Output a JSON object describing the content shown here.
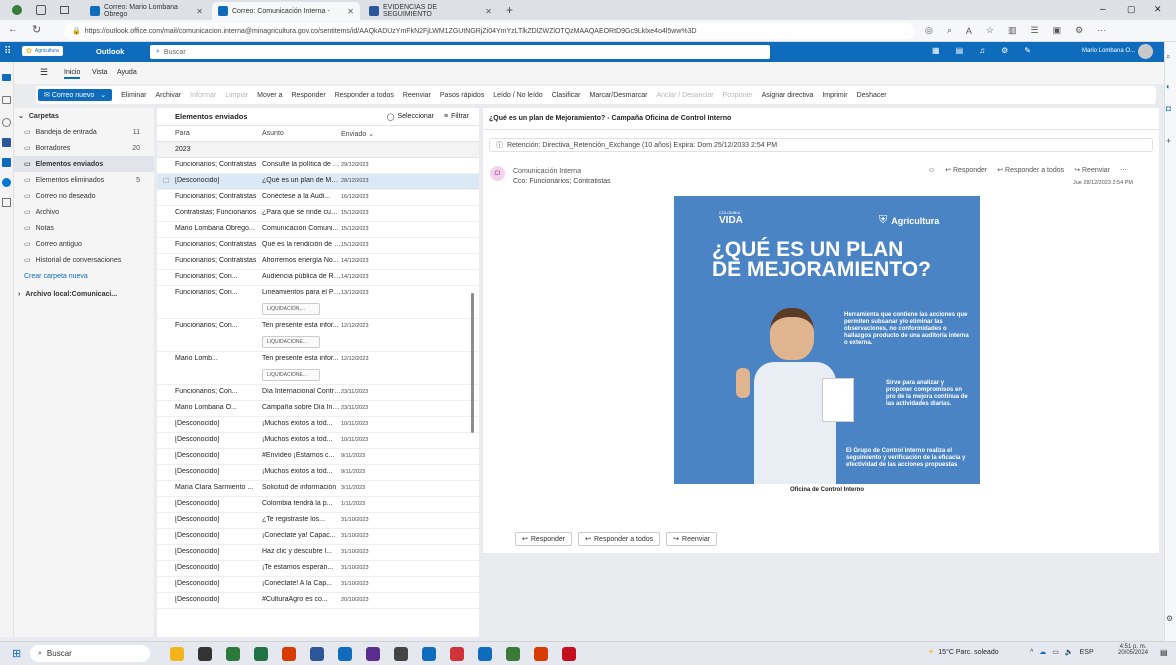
{
  "browser": {
    "tabs": [
      {
        "title": "Correo: Mario Lombana Obrego"
      },
      {
        "title": "Correo: Comunicación Interna -"
      },
      {
        "title": "EVIDENCIAS DE SEGUIMIENTO"
      }
    ],
    "new_tab": "+",
    "url": "https://outlook.office.com/mail/comunicacion.interna@minagricultura.gov.co/sentitems/id/AAQkADUzYmFkN2FjLWM1ZGUtNGRjZi04YmYzLTlkZDlZWZlOTQzMAAQAEORtD9Gc9Lklxe4o4l5ww%3D"
  },
  "header": {
    "brand": "Agricultura",
    "app": "Outlook",
    "search_placeholder": "Buscar",
    "user": "Mario Lombana O..."
  },
  "ribbon_tabs": [
    "Inicio",
    "Vista",
    "Ayuda"
  ],
  "ribbon": {
    "new_mail": "Correo nuevo",
    "buttons": [
      {
        "label": "Eliminar",
        "disabled": false
      },
      {
        "label": "Archivar",
        "disabled": false
      },
      {
        "label": "Informar",
        "disabled": true
      },
      {
        "label": "Limpiar",
        "disabled": true
      },
      {
        "label": "Mover a",
        "disabled": false
      },
      {
        "label": "Responder",
        "disabled": false
      },
      {
        "label": "Responder a todos",
        "disabled": false
      },
      {
        "label": "Reenviar",
        "disabled": false
      },
      {
        "label": "Pasos rápidos",
        "disabled": false
      },
      {
        "label": "Leído / No leído",
        "disabled": false
      },
      {
        "label": "Clasificar",
        "disabled": false
      },
      {
        "label": "Marcar/Desmarcar",
        "disabled": false
      },
      {
        "label": "Anclar / Desanclar",
        "disabled": true
      },
      {
        "label": "Posponer",
        "disabled": true
      },
      {
        "label": "Asignar directiva",
        "disabled": false
      },
      {
        "label": "Imprimir",
        "disabled": false
      },
      {
        "label": "Deshacer",
        "disabled": false
      }
    ]
  },
  "folders": {
    "title": "Carpetas",
    "items": [
      {
        "label": "Bandeja de entrada",
        "count": "11"
      },
      {
        "label": "Borradores",
        "count": "20"
      },
      {
        "label": "Elementos enviados",
        "count": "",
        "selected": true
      },
      {
        "label": "Elementos eliminados",
        "count": "5"
      },
      {
        "label": "Correo no deseado",
        "count": ""
      },
      {
        "label": "Archivo",
        "count": ""
      },
      {
        "label": "Notas",
        "count": ""
      },
      {
        "label": "Correo antiguo",
        "count": ""
      },
      {
        "label": "Historial de conversaciones",
        "count": ""
      }
    ],
    "create": "Crear carpeta nueva",
    "archive": "Archivo local:Comunicaci..."
  },
  "list": {
    "title": "Elementos enviados",
    "select": "Seleccionar",
    "filter": "Filtrar",
    "headers": [
      "Para",
      "Asunto",
      "Enviado"
    ],
    "group": "2023",
    "rows": [
      {
        "to": "Funcionarios; Contratistas",
        "subject": "Consulte la política de A...",
        "date": "29/12/2023"
      },
      {
        "to": "[Desconocido]",
        "subject": "¿Qué es un plan de Mej...",
        "date": "28/12/2023",
        "selected": true
      },
      {
        "to": "Funcionarios; Contratistas",
        "subject": "Conéctese a la Audi...",
        "date": "16/12/2023"
      },
      {
        "to": "Contratistas; Funcionarios",
        "subject": "¿Para qué se rinde cuen...",
        "date": "15/12/2023"
      },
      {
        "to": "Mario Lombana Obrego...",
        "subject": "Comunicación  Comuni...",
        "date": "15/12/2023"
      },
      {
        "to": "Funcionarios; Contratistas",
        "subject": "Qué es la rendición de c...",
        "date": "15/12/2023"
      },
      {
        "to": "Funcionarios; Contratistas",
        "subject": "Ahorremos energía  No...",
        "date": "14/12/2023"
      },
      {
        "to": "Funcionarios; Con...",
        "subject": "Audiencia pública de Re...",
        "date": "14/12/2023"
      },
      {
        "to": "Funcionarios; Con...",
        "subject": "Lineamientos para el Pr...",
        "date": "13/12/2023",
        "attachment": "LIQUIDACIÓN,..."
      },
      {
        "to": "Funcionarios; Con...",
        "subject": "Ten presente esta infor...",
        "date": "12/12/2023",
        "attachment": "LIQUIDACIONE..."
      },
      {
        "to": "Mario Lomb...",
        "subject": "Ten presente esta infor...",
        "date": "12/12/2023",
        "attachment": "LIQUIDACIONE..."
      },
      {
        "to": "Funcionarios; Con...",
        "subject": "Día Internacional Contra...",
        "date": "23/11/2023"
      },
      {
        "to": "Mario Lombana O...",
        "subject": "Campaña sobre Día Inte...",
        "date": "23/11/2023"
      },
      {
        "to": "[Desconocido]",
        "subject": "¡Muchos éxitos a tod...",
        "date": "10/11/2023"
      },
      {
        "to": "[Desconocido]",
        "subject": "¡Muchos éxitos a tod...",
        "date": "10/11/2023"
      },
      {
        "to": "[Desconocido]",
        "subject": "#Envídeo ¡Estamos c...",
        "date": "9/11/2023"
      },
      {
        "to": "[Desconocido]",
        "subject": "¡Muchos éxitos a tod...",
        "date": "9/11/2023"
      },
      {
        "to": "María Clara Sarmiento ...",
        "subject": "Solicitud de información",
        "date": "3/11/2023"
      },
      {
        "to": "[Desconocido]",
        "subject": "Colombia tendrá la p...",
        "date": "1/11/2023"
      },
      {
        "to": "[Desconocido]",
        "subject": "¿Te registraste los...",
        "date": "31/10/2023"
      },
      {
        "to": "[Desconocido]",
        "subject": "¡Conéctate ya! Capac...",
        "date": "31/10/2023"
      },
      {
        "to": "[Desconocido]",
        "subject": "Haz clic y descubre l...",
        "date": "31/10/2023"
      },
      {
        "to": "[Desconocido]",
        "subject": "¡Te estamos esperan...",
        "date": "31/10/2023"
      },
      {
        "to": "[Desconocido]",
        "subject": "¡Conéctate! A la Cap...",
        "date": "31/10/2023"
      },
      {
        "to": "[Desconocido]",
        "subject": "#CulturaAgro es co...",
        "date": "20/10/2023"
      }
    ]
  },
  "reading": {
    "subject": "¿Qué es un plan de Mejoramiento? - Campaña Oficina de Control Interno",
    "retention": "Retención: Directiva_Retención_Exchange (10 años) Expira: Dom 25/12/2033 2:54 PM",
    "sender": "Comunicación Interna",
    "cco": "Cco: Funcionarios; Contratistas",
    "avatar": "CI",
    "date": "Jue 28/12/2023 2:54 PM",
    "actions": [
      "Responder",
      "Responder a todos",
      "Reenviar"
    ],
    "poster": {
      "logo_top": "COLOMBIA",
      "logo_bottom": "VIDA",
      "ministry": "Agricultura",
      "title1": "¿QUÉ ES UN PLAN",
      "title2": "DE MEJORAMIENTO?",
      "p1": "Herramienta que contiene las acciones que permiten subsanar y/o eliminar las observaciones, no conformidades o hallazgos producto de una auditoría interna o externa.",
      "p2": "Sirve para analizar y proponer compromisos en pro de la mejora continua de las actividades diarias.",
      "p3": "El Grupo de Control Interno realiza el seguimiento y verificación de la eficacia y efectividad de las acciones propuestas",
      "footer": "Oficina de Control Interno"
    }
  },
  "taskbar": {
    "search": "Buscar",
    "weather": "15°C  Parc. soleado",
    "lang": "ESP",
    "time": "4:51 p. m.",
    "date": "20/05/2024"
  },
  "colors": {
    "accent": "#0f6cbd",
    "poster_bg": "#4a84c4",
    "poster_title": "#ffffff"
  }
}
